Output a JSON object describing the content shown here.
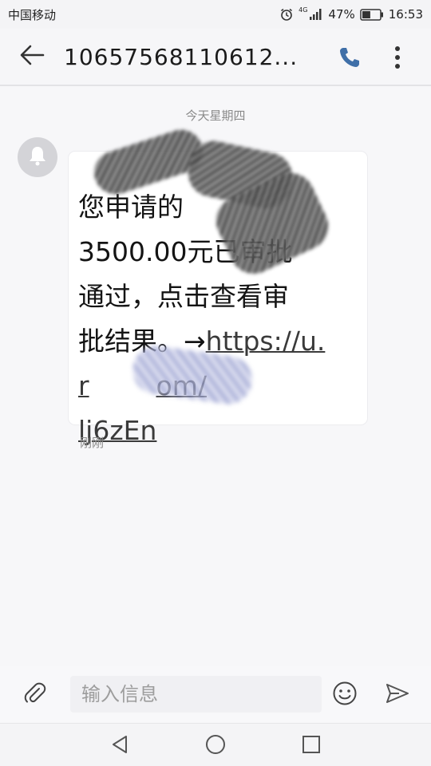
{
  "status_bar": {
    "carrier": "中国移动",
    "network": "4G",
    "battery": "47%",
    "battery_level": 0.47,
    "time": "16:53",
    "icons": [
      "alarm-icon",
      "signal-icon",
      "battery-icon"
    ]
  },
  "app_bar": {
    "contact": "10657568110612...",
    "icons": [
      "back-arrow-icon",
      "phone-icon",
      "more-vert-icon"
    ]
  },
  "conversation": {
    "date_divider": "今天星期四",
    "messages": [
      {
        "text": "您申请的",
        "amount_line": "3500.00元已审批",
        "line2": "通过，点击查看审",
        "line3": "批结果。→",
        "link": "https://u.r",
        "link_mid": "om/",
        "link_tail": "lj6zEn",
        "timestamp": "刚刚"
      }
    ]
  },
  "composer": {
    "placeholder": "输入信息",
    "icons": [
      "attachment-icon",
      "emoji-icon",
      "send-icon"
    ]
  },
  "nav_bar": {
    "icons": [
      "nav-back-icon",
      "nav-home-icon",
      "nav-recents-icon"
    ]
  }
}
